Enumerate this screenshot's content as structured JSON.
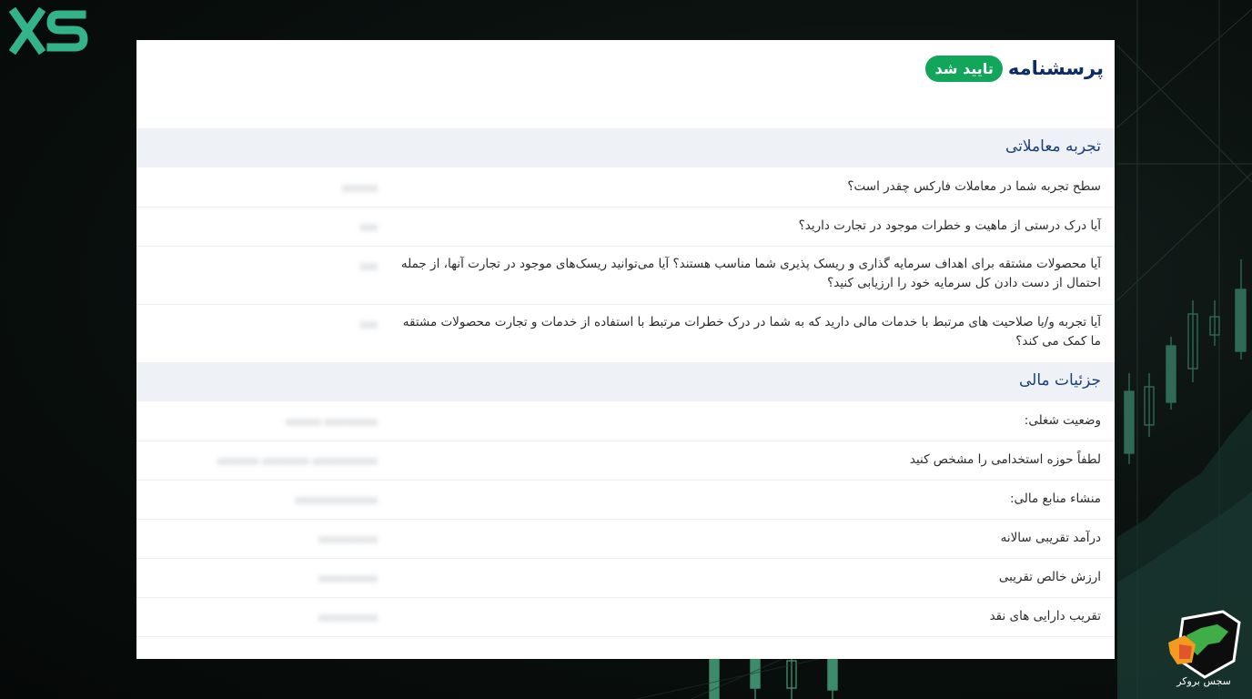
{
  "brand": {
    "logo_text": "XS",
    "watermark_text": "سجس بروکر"
  },
  "header": {
    "title": "پرسشنامه",
    "badge": "تایید شد"
  },
  "sections": [
    {
      "title": "تجربه معاملاتی",
      "rows": [
        {
          "question": "سطح تجربه شما در معاملات فارکس چقدر است؟",
          "answer": "xxxxxx"
        },
        {
          "question": "آیا درک درستی از ماهیت و خطرات موجود در تجارت دارید؟",
          "answer": "xxx"
        },
        {
          "question": "آیا محصولات مشتقه برای اهداف سرمایه گذاری و ریسک پذیری شما مناسب هستند؟ آیا می‌توانید ریسک‌های موجود در تجارت آنها، از جمله احتمال از دست دادن کل سرمایه خود را ارزیابی کنید؟",
          "answer": "xxx"
        },
        {
          "question": "آیا تجربه و/یا صلاحیت های مرتبط با خدمات مالی دارید که به شما در درک خطرات مرتبط با استفاده از خدمات و تجارت محصولات مشتقه ما کمک می کند؟",
          "answer": "xxx"
        }
      ]
    },
    {
      "title": "جزئیات مالی",
      "rows": [
        {
          "question": "وضعیت شغلی:",
          "answer": "xxxxxx xxxxxxxxx"
        },
        {
          "question": "لطفاً حوزه استخدامی را مشخص کنید",
          "answer": "xxxxxxx xxxxxxxx xxxxxxxxxxx"
        },
        {
          "question": "منشاء منابع مالی:",
          "answer": "xxxxxxxxxxxxxx"
        },
        {
          "question": "درآمد تقریبی سالانه",
          "answer": "xxxxxxxxxx"
        },
        {
          "question": "ارزش خالص تقریبی",
          "answer": "xxxxxxxxxx"
        },
        {
          "question": "تقریب دارایی های نقد",
          "answer": "xxxxxxxxxx"
        }
      ]
    }
  ]
}
